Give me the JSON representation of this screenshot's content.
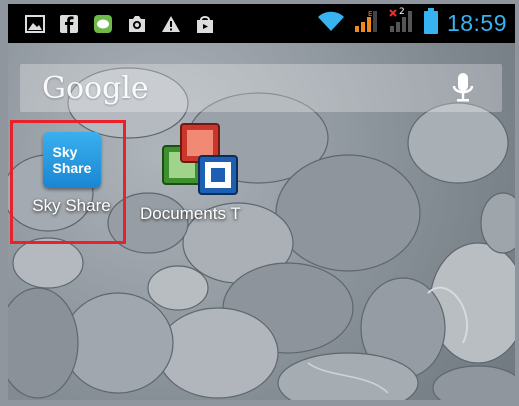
{
  "status_bar": {
    "time": "18:59",
    "notification_icons": [
      "image-icon",
      "facebook-icon",
      "green-app-icon",
      "camera-icon",
      "warning-icon",
      "shopping-bag-icon"
    ],
    "system_icons": [
      "wifi-icon",
      "signal-sim1-icon",
      "signal-sim2-no-service-icon",
      "battery-icon"
    ],
    "sim2_badge": "2",
    "accent_color": "#37b3f0"
  },
  "search": {
    "logo_text": "Google",
    "mic_icon": "microphone-icon"
  },
  "apps": [
    {
      "label": "Sky Share",
      "tile_line1": "Sky",
      "tile_line2": "Share",
      "highlighted": true
    },
    {
      "label": "Documents T",
      "icon": "documents-to-go-icon",
      "highlighted": false
    }
  ],
  "highlight_color": "#e8212b"
}
